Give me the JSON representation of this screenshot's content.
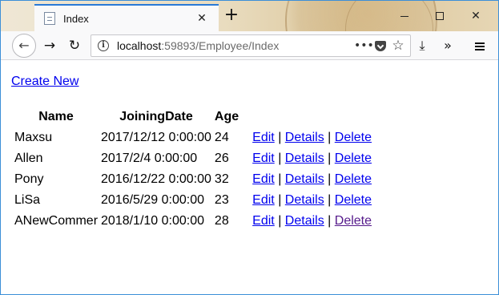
{
  "browser": {
    "tab_title": "Index",
    "url_host": "localhost",
    "url_rest": ":59893/Employee/Index"
  },
  "page": {
    "create_new": "Create New",
    "columns": [
      "Name",
      "JoiningDate",
      "Age"
    ],
    "rows": [
      {
        "name": "Maxsu",
        "joining_date": "2017/12/12 0:00:00",
        "age": "24"
      },
      {
        "name": "Allen",
        "joining_date": "2017/2/4 0:00:00",
        "age": "26"
      },
      {
        "name": "Pony",
        "joining_date": "2016/12/22 0:00:00",
        "age": "32"
      },
      {
        "name": "LiSa",
        "joining_date": "2016/5/29 0:00:00",
        "age": "23"
      },
      {
        "name": "ANewCommer",
        "joining_date": "2018/1/10 0:00:00",
        "age": "28"
      }
    ],
    "actions": {
      "edit": "Edit",
      "details": "Details",
      "delete": "Delete",
      "separator": "|"
    }
  },
  "colors": {
    "link": "#0000ee",
    "visited_link": "#551a8b",
    "tab_accent": "#2a7ad6",
    "window_border": "#3c8fd8"
  },
  "icons": {
    "back": "back-arrow-icon",
    "forward": "forward-arrow-icon",
    "reload": "reload-icon",
    "info": "info-icon",
    "page_actions": "more-dots-icon",
    "pocket": "pocket-icon",
    "bookmark": "star-icon",
    "download": "download-icon",
    "overflow": "double-chevron-icon",
    "menu": "hamburger-menu-icon",
    "new_tab": "plus-icon",
    "close_tab": "close-icon",
    "favicon": "page-icon"
  }
}
